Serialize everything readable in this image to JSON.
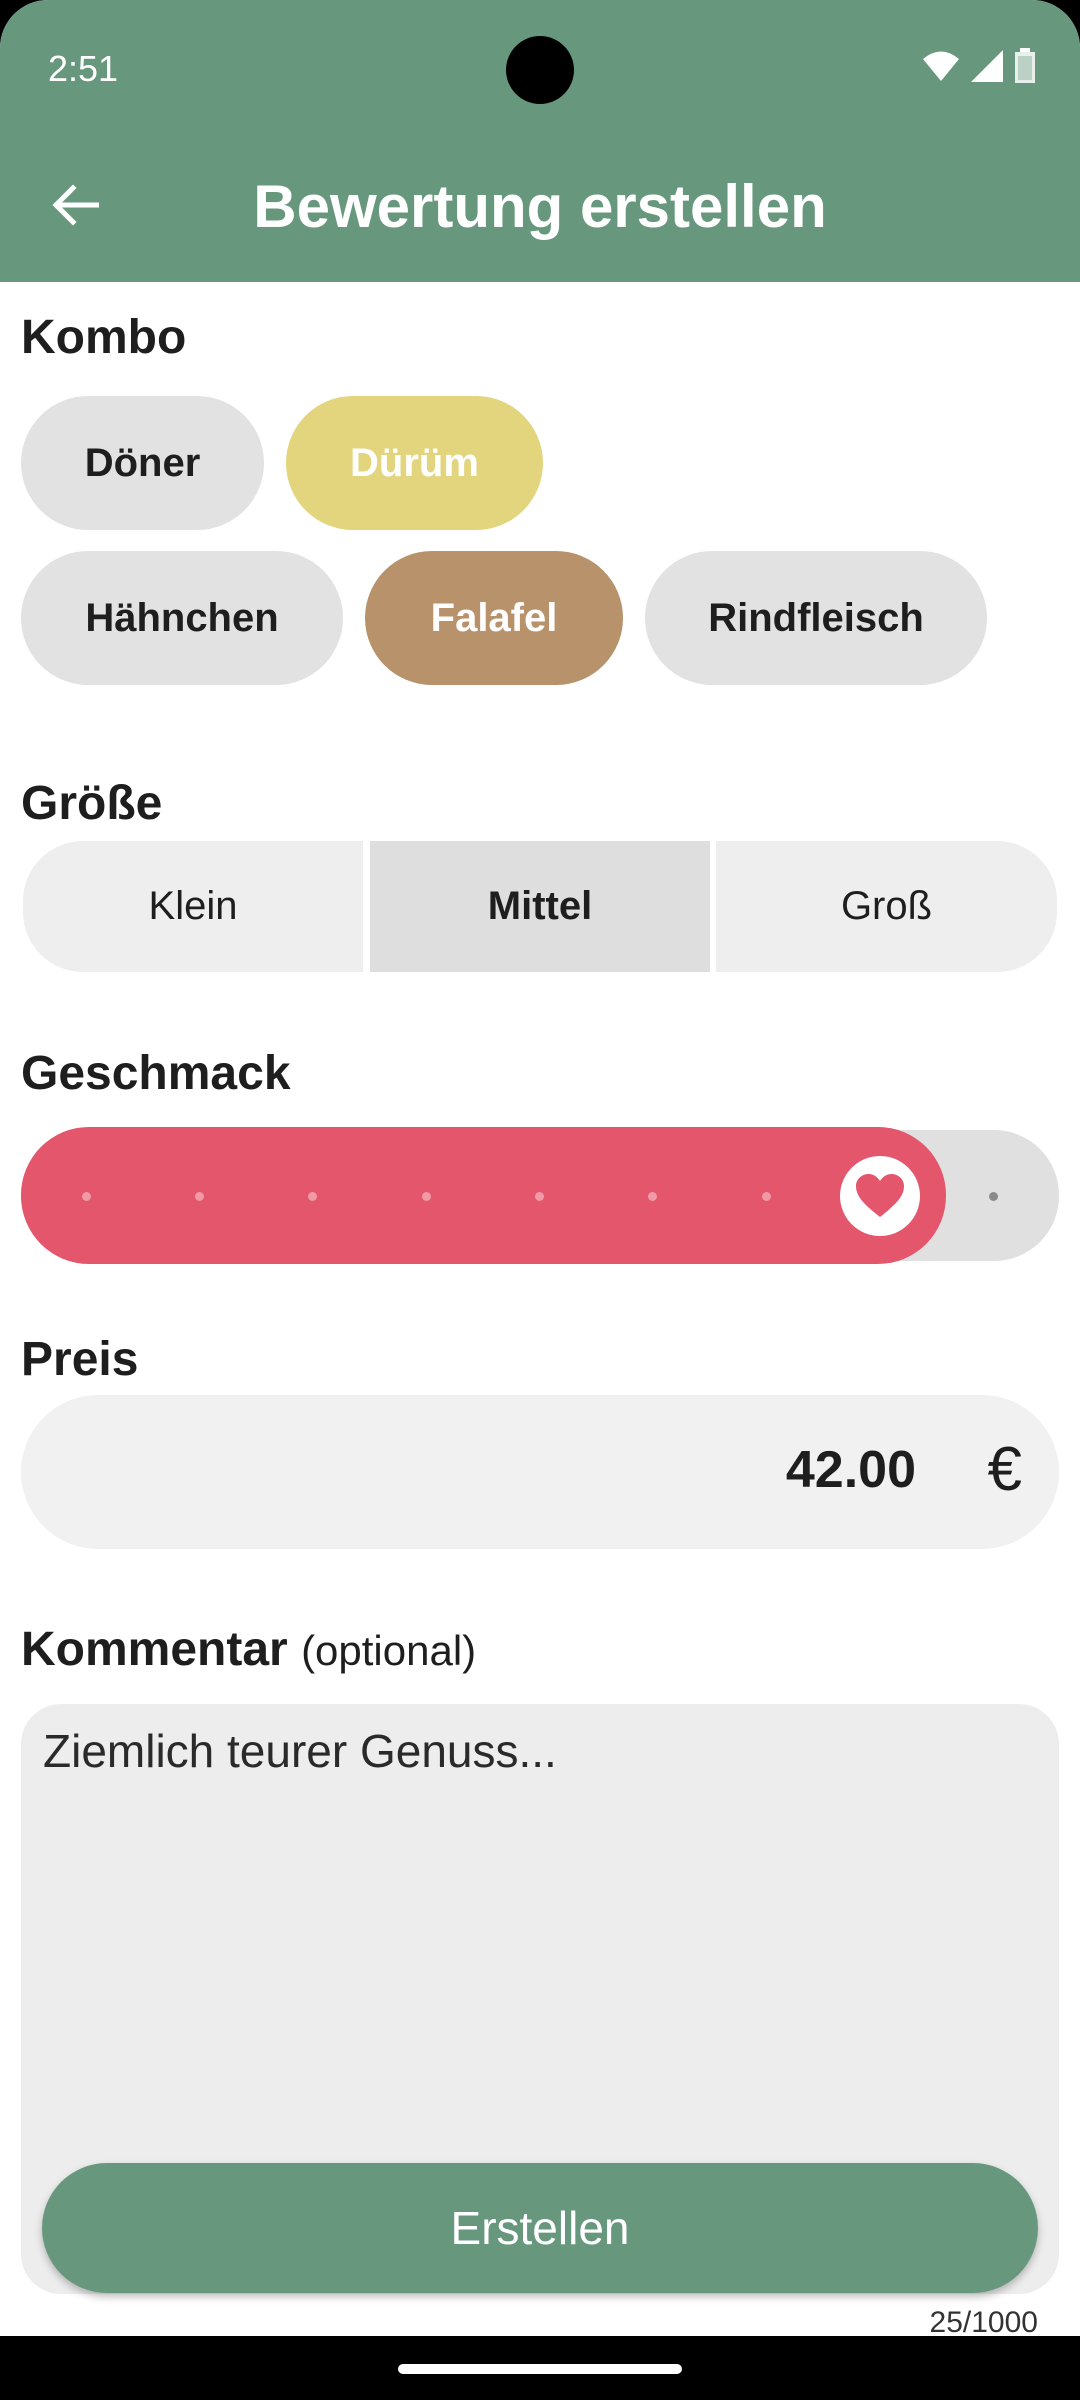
{
  "status_bar": {
    "time": "2:51"
  },
  "header": {
    "title": "Bewertung erstellen",
    "back_icon": "arrow-back-icon"
  },
  "kombo": {
    "label": "Kombo",
    "options": [
      {
        "label": "Döner",
        "color": "#e2e2e2",
        "text_color": "#1e1e1e"
      },
      {
        "label": "Dürüm",
        "color": "#e2d57e",
        "text_color": "#ffffff"
      },
      {
        "label": "Hähnchen",
        "color": "#e2e2e2",
        "text_color": "#1e1e1e"
      },
      {
        "label": "Falafel",
        "color": "#b8926a",
        "text_color": "#ffffff"
      },
      {
        "label": "Rindfleisch",
        "color": "#e2e2e2",
        "text_color": "#1e1e1e"
      }
    ]
  },
  "groesse": {
    "label": "Größe",
    "options": [
      "Klein",
      "Mittel",
      "Groß"
    ],
    "selected": "Mittel"
  },
  "geschmack": {
    "label": "Geschmack",
    "value": 8,
    "max": 9,
    "thumb_icon": "heart-icon",
    "accent": "#e3566c"
  },
  "preis": {
    "label": "Preis",
    "value": "42.00",
    "currency": "€"
  },
  "kommentar": {
    "label": "Kommentar",
    "optional_label": "(optional)",
    "value": "Ziemlich teurer Genuss...",
    "counter": "25/1000"
  },
  "submit": {
    "label": "Erstellen",
    "color": "#67987e"
  }
}
